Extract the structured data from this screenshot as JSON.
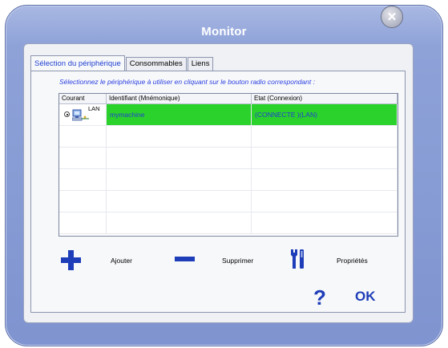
{
  "window": {
    "title": "Monitor"
  },
  "tabs": [
    {
      "label": "Sélection du périphérique"
    },
    {
      "label": "Consommables"
    },
    {
      "label": "Liens"
    }
  ],
  "instruction": "Sélectionnez le périphérique à utiliser en cliquant sur le bouton radio correspondant :",
  "table": {
    "headers": [
      "Courant",
      "Identifiant (Mnémonique)",
      "Etat (Connexion)"
    ],
    "rows": [
      {
        "type": "LAN",
        "identifiant": "mymachine",
        "etat": "(CONNECTE )(LAN)",
        "selected": true
      }
    ],
    "selected_color": "#2cd22c"
  },
  "actions": {
    "add": "Ajouter",
    "remove": "Supprimer",
    "properties": "Propriétés",
    "help": "?",
    "ok": "OK"
  },
  "icons": [
    "close-icon",
    "computer-network-icon",
    "plus-icon",
    "minus-icon",
    "tools-icon",
    "help-icon"
  ],
  "colors": {
    "accent": "#1e3db8",
    "window": "#8ea2d8"
  }
}
